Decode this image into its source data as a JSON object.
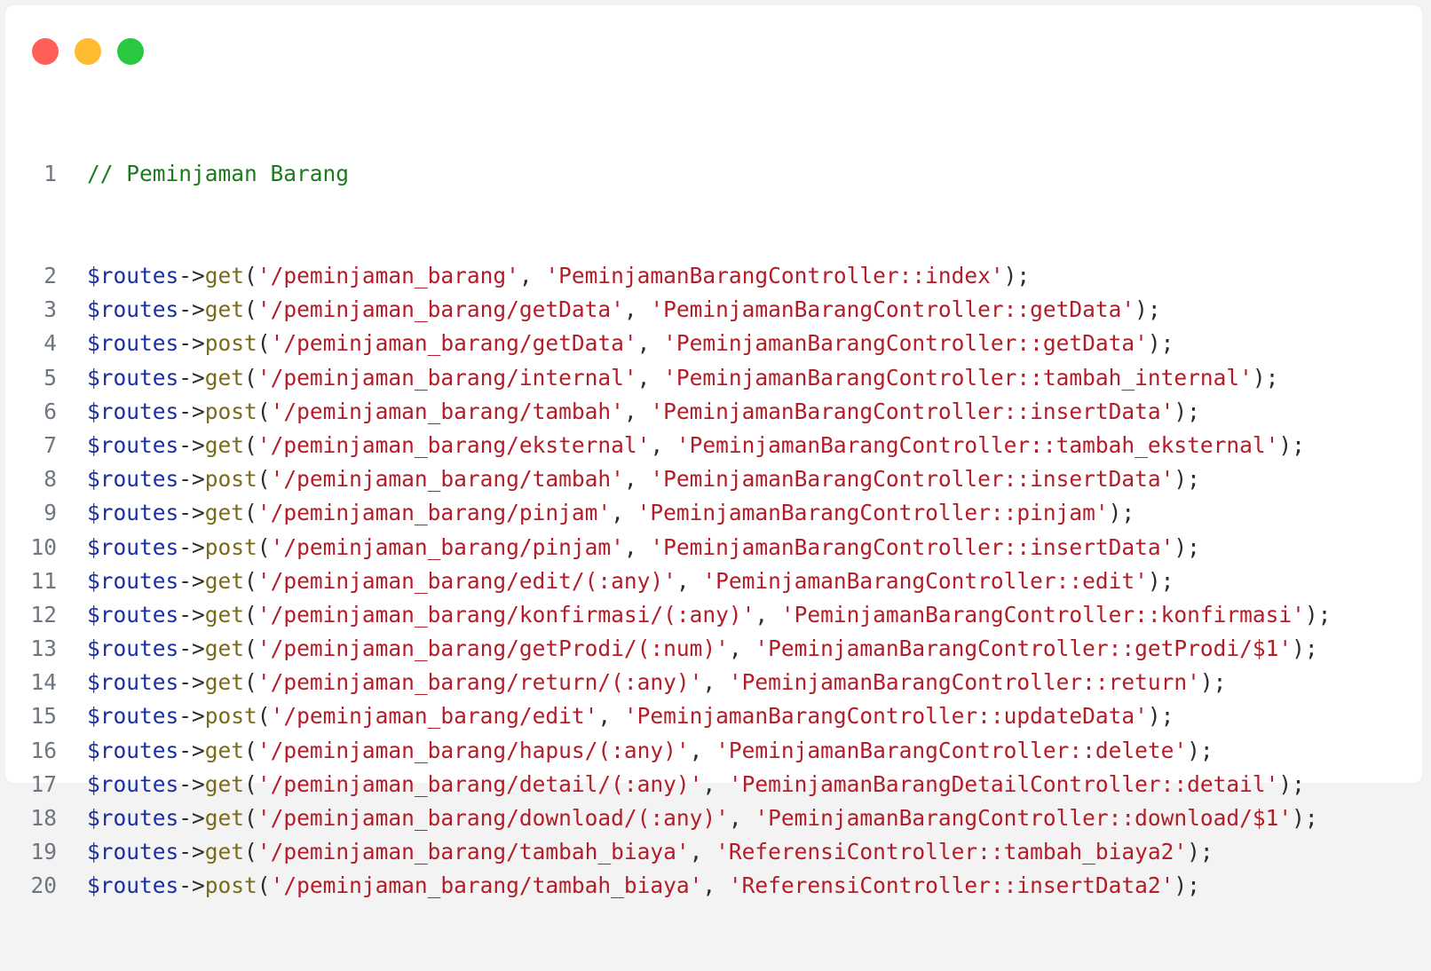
{
  "window": {
    "controls": [
      {
        "name": "close",
        "color": "#ff5f57"
      },
      {
        "name": "minimize",
        "color": "#febc2e"
      },
      {
        "name": "maximize",
        "color": "#28c840"
      }
    ]
  },
  "colors": {
    "comment": "#1b7a1b",
    "variable": "#1a2fa3",
    "method": "#7a6a1a",
    "string": "#b31d28"
  },
  "comment_line": {
    "number": "1",
    "text": "// Peminjaman Barang"
  },
  "routes": [
    {
      "number": "2",
      "var": "$routes",
      "arrow": "->",
      "method": "get",
      "path": "'/peminjaman_barang'",
      "handler": "'PeminjamanBarangController::index'"
    },
    {
      "number": "3",
      "var": "$routes",
      "arrow": "->",
      "method": "get",
      "path": "'/peminjaman_barang/getData'",
      "handler": "'PeminjamanBarangController::getData'"
    },
    {
      "number": "4",
      "var": "$routes",
      "arrow": "->",
      "method": "post",
      "path": "'/peminjaman_barang/getData'",
      "handler": "'PeminjamanBarangController::getData'"
    },
    {
      "number": "5",
      "var": "$routes",
      "arrow": "->",
      "method": "get",
      "path": "'/peminjaman_barang/internal'",
      "handler": "'PeminjamanBarangController::tambah_internal'"
    },
    {
      "number": "6",
      "var": "$routes",
      "arrow": "->",
      "method": "post",
      "path": "'/peminjaman_barang/tambah'",
      "handler": "'PeminjamanBarangController::insertData'"
    },
    {
      "number": "7",
      "var": "$routes",
      "arrow": "->",
      "method": "get",
      "path": "'/peminjaman_barang/eksternal'",
      "handler": "'PeminjamanBarangController::tambah_eksternal'"
    },
    {
      "number": "8",
      "var": "$routes",
      "arrow": "->",
      "method": "post",
      "path": "'/peminjaman_barang/tambah'",
      "handler": "'PeminjamanBarangController::insertData'"
    },
    {
      "number": "9",
      "var": "$routes",
      "arrow": "->",
      "method": "get",
      "path": "'/peminjaman_barang/pinjam'",
      "handler": "'PeminjamanBarangController::pinjam'"
    },
    {
      "number": "10",
      "var": "$routes",
      "arrow": "->",
      "method": "post",
      "path": "'/peminjaman_barang/pinjam'",
      "handler": "'PeminjamanBarangController::insertData'"
    },
    {
      "number": "11",
      "var": "$routes",
      "arrow": "->",
      "method": "get",
      "path": "'/peminjaman_barang/edit/(:any)'",
      "handler": "'PeminjamanBarangController::edit'"
    },
    {
      "number": "12",
      "var": "$routes",
      "arrow": "->",
      "method": "get",
      "path": "'/peminjaman_barang/konfirmasi/(:any)'",
      "handler": "'PeminjamanBarangController::konfirmasi'"
    },
    {
      "number": "13",
      "var": "$routes",
      "arrow": "->",
      "method": "get",
      "path": "'/peminjaman_barang/getProdi/(:num)'",
      "handler": "'PeminjamanBarangController::getProdi/$1'"
    },
    {
      "number": "14",
      "var": "$routes",
      "arrow": "->",
      "method": "get",
      "path": "'/peminjaman_barang/return/(:any)'",
      "handler": "'PeminjamanBarangController::return'"
    },
    {
      "number": "15",
      "var": "$routes",
      "arrow": "->",
      "method": "post",
      "path": "'/peminjaman_barang/edit'",
      "handler": "'PeminjamanBarangController::updateData'"
    },
    {
      "number": "16",
      "var": "$routes",
      "arrow": "->",
      "method": "get",
      "path": "'/peminjaman_barang/hapus/(:any)'",
      "handler": "'PeminjamanBarangController::delete'"
    },
    {
      "number": "17",
      "var": "$routes",
      "arrow": "->",
      "method": "get",
      "path": "'/peminjaman_barang/detail/(:any)'",
      "handler": "'PeminjamanBarangDetailController::detail'"
    },
    {
      "number": "18",
      "var": "$routes",
      "arrow": "->",
      "method": "get",
      "path": "'/peminjaman_barang/download/(:any)'",
      "handler": "'PeminjamanBarangController::download/$1'"
    },
    {
      "number": "19",
      "var": "$routes",
      "arrow": "->",
      "method": "get",
      "path": "'/peminjaman_barang/tambah_biaya'",
      "handler": "'ReferensiController::tambah_biaya2'"
    },
    {
      "number": "20",
      "var": "$routes",
      "arrow": "->",
      "method": "post",
      "path": "'/peminjaman_barang/tambah_biaya'",
      "handler": "'ReferensiController::insertData2'"
    }
  ]
}
